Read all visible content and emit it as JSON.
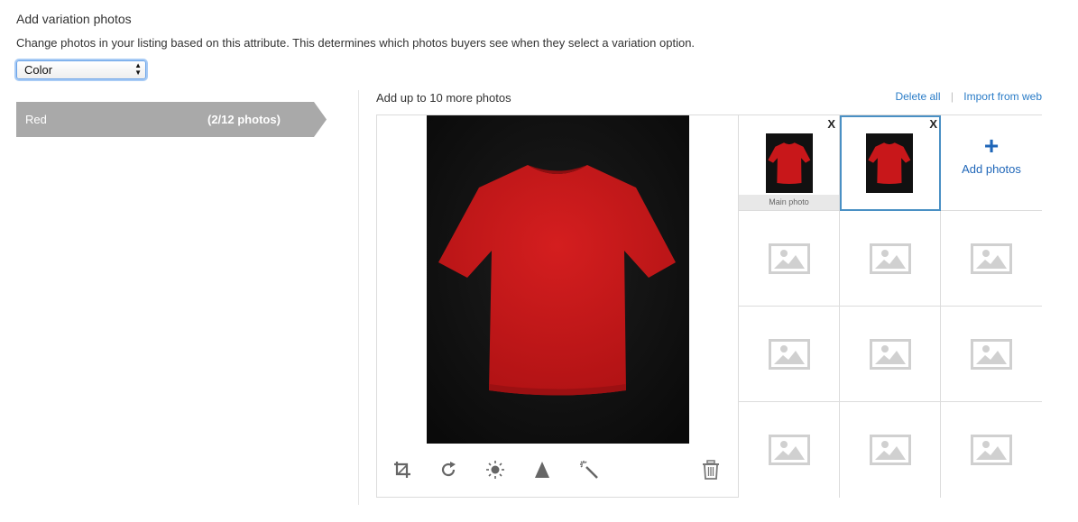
{
  "header": {
    "title": "Add variation photos",
    "description": "Change photos in your listing based on this attribute. This determines which photos buyers see when they select a variation option."
  },
  "attribute_select": {
    "selected": "Color",
    "arrows": "▲▼"
  },
  "variation": {
    "name": "Red",
    "count": "(2/12 photos)",
    "tab_color": "#a9a9a9"
  },
  "upload": {
    "title": "Add up to 10 more photos",
    "delete_all": "Delete all",
    "separator": "|",
    "import_web": "Import from web"
  },
  "tools": [
    "crop-icon",
    "rotate-icon",
    "brightness-icon",
    "contrast-icon",
    "magic-wand-icon",
    "trash-icon"
  ],
  "photos": {
    "main_label": "Main photo",
    "close_label": "X",
    "add_plus": "+",
    "add_label": "Add photos",
    "selected_border": "#4a90c4",
    "tshirt_color": "#c8171a"
  }
}
